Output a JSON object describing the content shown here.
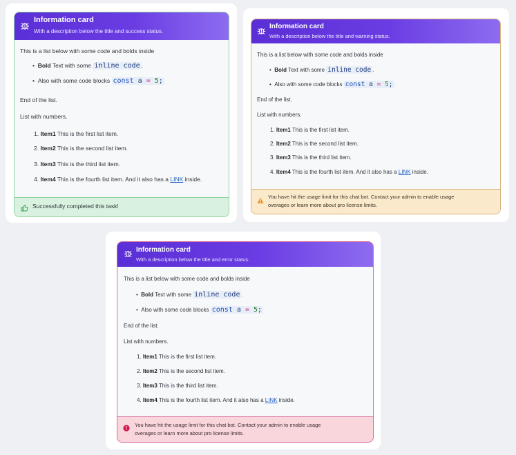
{
  "cards": [
    {
      "title": "Information card",
      "subtitle": "With a description below the title and success status.",
      "intro": "This is a list below with some code and bolds inside",
      "bullet1_bold": "Bold",
      "bullet1_text": "Text with some",
      "bullet1_code": "inline code",
      "bullet1_after": ".",
      "bullet2_text": "Also with some code blocks",
      "code_block_kw": "const",
      "code_block_var": "a",
      "code_block_op": "=",
      "code_block_num": "5",
      "code_block_end": ";",
      "end_text": "End of the list.",
      "numbers_heading": "List with numbers.",
      "items": [
        {
          "num": "1.",
          "bold": "Item1",
          "text": "This is the first list item."
        },
        {
          "num": "2.",
          "bold": "Item2",
          "text": "This is the second list item."
        },
        {
          "num": "3.",
          "bold": "Item3",
          "text": "This is the third list item."
        },
        {
          "num": "4.",
          "bold": "Item4",
          "text": "This is the fourth list item. And it also has a",
          "link": "LINK",
          "after": "inside."
        }
      ],
      "status_type": "success",
      "status_text": "Successfully completed this task!"
    },
    {
      "title": "Information card",
      "subtitle": "With a description below the title and warning status.",
      "intro": "This is a list below with some code and bolds inside",
      "bullet1_bold": "Bold",
      "bullet1_text": "Text with some",
      "bullet1_code": "inline code",
      "bullet1_after": ".",
      "bullet2_text": "Also with some code blocks",
      "code_block_kw": "const",
      "code_block_var": "a",
      "code_block_op": "=",
      "code_block_num": "5",
      "code_block_end": ";",
      "end_text": "End of the list.",
      "numbers_heading": "List with numbers.",
      "items": [
        {
          "num": "1.",
          "bold": "Item1",
          "text": "This is the first list item."
        },
        {
          "num": "2.",
          "bold": "Item2",
          "text": "This is the second list item."
        },
        {
          "num": "3.",
          "bold": "Item3",
          "text": "This is the third list item."
        },
        {
          "num": "4.",
          "bold": "Item4",
          "text": "This is the fourth list item. And it also has a",
          "link": "LINK",
          "after": "inside."
        }
      ],
      "status_type": "warning",
      "status_line1": "You have hit the usage limit for this chat bot. Contact your admin to enable usage",
      "status_line2": "overages or learn more about pro license limits."
    },
    {
      "title": "Information card",
      "subtitle": "With a description below the title and error status.",
      "intro": "This is a list below with some code and bolds inside",
      "bullet1_bold": "Bold",
      "bullet1_text": "Text with some",
      "bullet1_code": "inline code",
      "bullet1_after": ".",
      "bullet2_text": "Also with some code blocks",
      "code_block_kw": "const",
      "code_block_var": "a",
      "code_block_op": "=",
      "code_block_num": "5",
      "code_block_end": ";",
      "end_text": "End of the list.",
      "numbers_heading": "List with numbers.",
      "items": [
        {
          "num": "1.",
          "bold": "Item1",
          "text": "This is the first list item."
        },
        {
          "num": "2.",
          "bold": "Item2",
          "text": "This is the second list item."
        },
        {
          "num": "3.",
          "bold": "Item3",
          "text": "This is the third list item."
        },
        {
          "num": "4.",
          "bold": "Item4",
          "text": "This is the fourth list item. And it also has a",
          "link": "LINK",
          "after": "inside."
        }
      ],
      "status_type": "error",
      "status_line1": "You have hit the usage limit for this chat bot. Contact your admin to enable usage",
      "status_line2": "overages or learn more about pro license limits."
    }
  ],
  "colors": {
    "header_gradient_start": "#5b2fd6",
    "header_gradient_end": "#8d6cf0",
    "success_bg": "#d9f2df",
    "success_icon": "#2e9e4f",
    "warning_bg": "#fbe9cc",
    "warning_icon": "#e59a1c",
    "error_bg": "#f9d6dc",
    "error_icon": "#d11a4f"
  }
}
